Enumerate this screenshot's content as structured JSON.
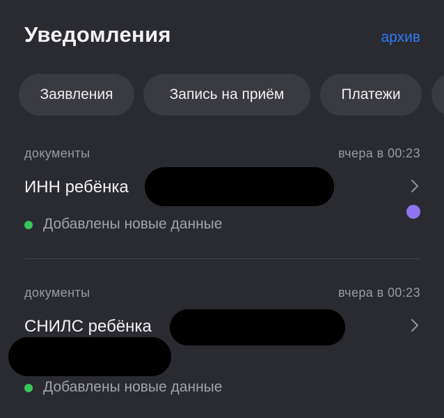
{
  "header": {
    "title": "Уведомления",
    "archive_label": "архив"
  },
  "chips": [
    {
      "label": "Заявления"
    },
    {
      "label": "Запись на приём"
    },
    {
      "label": "Платежи"
    }
  ],
  "notifications": [
    {
      "category": "документы",
      "time": "вчера в 00:23",
      "title": "ИНН ребёнка",
      "status": "Добавлены новые данные",
      "unread": true
    },
    {
      "category": "документы",
      "time": "вчера в 00:23",
      "title": "СНИЛС ребёнка",
      "status": "Добавлены новые данные",
      "unread": false
    }
  ],
  "colors": {
    "background": "#2a2a31",
    "chip": "#3a3a41",
    "accent": "#2f7cf6",
    "status_dot": "#35c759",
    "unread_dot": "#8f74f2"
  },
  "icons": {
    "chevron": "chevron-right-icon",
    "status": "green-dot-icon"
  }
}
